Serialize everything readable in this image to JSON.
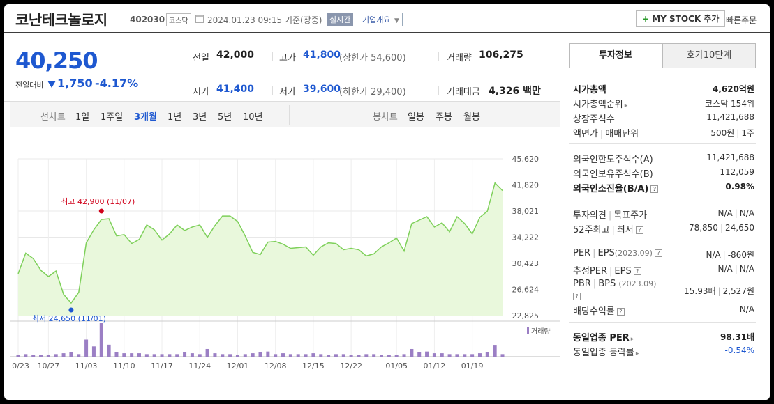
{
  "header": {
    "company_name": "코난테크놀로지",
    "stock_code": "402030",
    "market": "코스닥",
    "datetime": "2024.01.23 09:15",
    "basis": "기준(장중)",
    "realtime": "실시간",
    "company_info": "기업개요",
    "mystock_label": "MY STOCK 추가",
    "quick_order": "빠른주문"
  },
  "price": {
    "current": "40,250",
    "change_label": "전일대비",
    "change": "1,750",
    "change_rate": "-4.17%"
  },
  "stats": {
    "prev_close_label": "전일",
    "prev_close": "42,000",
    "high_label": "고가",
    "high": "41,800",
    "upper_limit_label": "(상한가",
    "upper_limit": "54,600)",
    "volume_label": "거래량",
    "volume": "106,275",
    "open_label": "시가",
    "open": "41,400",
    "low_label": "저가",
    "low": "39,600",
    "lower_limit_label": "(하한가",
    "lower_limit": "29,400)",
    "amount_label": "거래대금",
    "amount": "4,326",
    "amount_unit": "백만"
  },
  "toolbar": {
    "line_chart_label": "선차트",
    "periods": [
      "1일",
      "1주일",
      "3개월",
      "1년",
      "3년",
      "5년",
      "10년"
    ],
    "active_period": "3개월",
    "candle_chart_label": "봉차트",
    "candle_periods": [
      "일봉",
      "주봉",
      "월봉"
    ]
  },
  "tabs": {
    "info": "투자정보",
    "orderbook": "호가10단계"
  },
  "info": {
    "market_cap_label": "시가총액",
    "market_cap": "4,620억원",
    "cap_rank_label": "시가총액순위",
    "cap_rank": "코스닥 154위",
    "shares_label": "상장주식수",
    "shares": "11,421,688",
    "par_label": "액면가",
    "trade_unit_label": "매매단위",
    "par": "500원",
    "trade_unit": "1주",
    "foreign_limit_label": "외국인한도주식수(A)",
    "foreign_limit": "11,421,688",
    "foreign_hold_label": "외국인보유주식수(B)",
    "foreign_hold": "112,059",
    "foreign_ratio_label": "외국인소진율(B/A)",
    "foreign_ratio": "0.98%",
    "opinion_label": "투자의견",
    "target_label": "목표주가",
    "opinion": "N/A",
    "target": "N/A",
    "w52_high_label": "52주최고",
    "w52_low_label": "최저",
    "w52_high": "78,850",
    "w52_low": "24,650",
    "per_label": "PER",
    "eps_label": "EPS",
    "eps_period": "(2023.09)",
    "per": "N/A",
    "eps": "-860원",
    "est_per_label": "추정PER",
    "est_eps_label": "EPS",
    "est_per": "N/A",
    "est_eps": "N/A",
    "pbr_label": "PBR",
    "bps_label": "BPS",
    "bps_period": "(2023.09)",
    "pbr": "15.93배",
    "bps": "2,527원",
    "dividend_label": "배당수익률",
    "dividend": "N/A",
    "sector_per_label": "동일업종 PER",
    "sector_per": "98.31배",
    "sector_change_label": "동일업종 등락률",
    "sector_change": "-0.54%"
  },
  "colors": {
    "up": "#d0021b",
    "down": "#1e58d0",
    "line": "#7ed05a",
    "fill": "#e9f8dc",
    "volume": "#9b7fc4"
  },
  "chart_data": {
    "type": "area",
    "ylim": [
      22825,
      45620
    ],
    "y_ticks": [
      "45,620",
      "41,820",
      "38,021",
      "34,222",
      "30,423",
      "26,624",
      "22,825"
    ],
    "y_tick_values": [
      45620,
      41820,
      38021,
      34222,
      30423,
      26624,
      22825
    ],
    "x_tick_labels": [
      "10/23",
      "10/27",
      "11/03",
      "11/10",
      "11/17",
      "11/24",
      "12/01",
      "12/08",
      "12/15",
      "12/22",
      "01/05",
      "01/12",
      "01/19"
    ],
    "x_tick_index": [
      0,
      4,
      9,
      14,
      19,
      24,
      29,
      34,
      39,
      44,
      50,
      55,
      60
    ],
    "high_annotation": "최고 42,900 (11/07)",
    "low_annotation": "최저 24,650 (11/01)",
    "high_index": 11,
    "low_index": 7,
    "volume_label": "거래량",
    "prices": [
      28900,
      31900,
      31100,
      29400,
      28500,
      29300,
      25900,
      24650,
      26200,
      33400,
      35300,
      36800,
      36900,
      34400,
      34600,
      33300,
      33900,
      36000,
      35300,
      33800,
      34700,
      36000,
      35200,
      35700,
      36000,
      34200,
      35900,
      37300,
      37300,
      36500,
      34400,
      32000,
      31700,
      33500,
      33600,
      33200,
      32600,
      32700,
      32800,
      31600,
      32800,
      33400,
      33300,
      32400,
      32600,
      32400,
      31500,
      31800,
      32800,
      33400,
      34100,
      32200,
      36200,
      36700,
      37200,
      35700,
      36300,
      35000,
      37200,
      36200,
      34700,
      37100,
      38000,
      42100,
      41000
    ],
    "volumes": [
      2,
      3,
      2,
      2,
      2,
      3,
      4,
      5,
      3,
      20,
      12,
      40,
      14,
      5,
      4,
      4,
      4,
      3,
      3,
      3,
      3,
      3,
      5,
      4,
      3,
      9,
      4,
      3,
      3,
      2,
      3,
      4,
      5,
      6,
      3,
      4,
      3,
      3,
      3,
      4,
      3,
      2,
      3,
      3,
      2,
      2,
      3,
      3,
      2,
      2,
      2,
      3,
      9,
      5,
      6,
      4,
      4,
      3,
      3,
      3,
      3,
      4,
      5,
      13,
      3
    ],
    "volume_max": 40
  }
}
